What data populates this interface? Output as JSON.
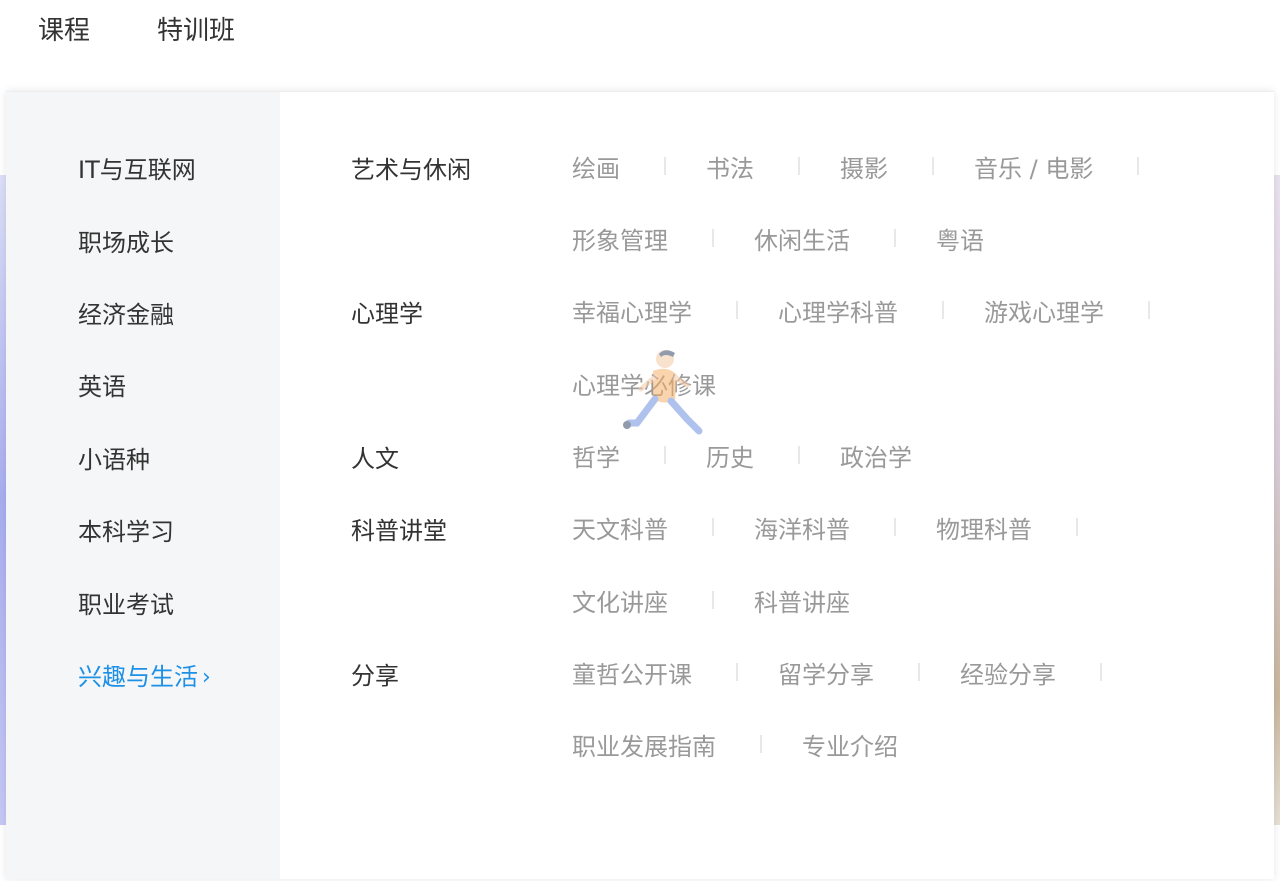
{
  "topnav": {
    "items": [
      {
        "label": "课程"
      },
      {
        "label": "特训班"
      }
    ]
  },
  "sidebar": {
    "categories": [
      {
        "label": "IT与互联网"
      },
      {
        "label": "职场成长"
      },
      {
        "label": "经济金融"
      },
      {
        "label": "英语"
      },
      {
        "label": "小语种"
      },
      {
        "label": "本科学习"
      },
      {
        "label": "职业考试"
      },
      {
        "label": "兴趣与生活",
        "active": true
      }
    ],
    "active_color": "#1e90e6"
  },
  "content": {
    "groups": [
      {
        "title": "艺术与休闲",
        "rows": [
          [
            "绘画",
            "书法",
            "摄影",
            "音乐 / 电影"
          ],
          [
            "形象管理",
            "休闲生活",
            "粤语"
          ]
        ]
      },
      {
        "title": "心理学",
        "rows": [
          [
            "幸福心理学",
            "心理学科普",
            "游戏心理学"
          ],
          [
            "心理学必修课"
          ]
        ]
      },
      {
        "title": "人文",
        "rows": [
          [
            "哲学",
            "历史",
            "政治学"
          ]
        ]
      },
      {
        "title": "科普讲堂",
        "rows": [
          [
            "天文科普",
            "海洋科普",
            "物理科普"
          ],
          [
            "文化讲座",
            "科普讲座"
          ]
        ]
      },
      {
        "title": "分享",
        "rows": [
          [
            "童哲公开课",
            "留学分享",
            "经验分享"
          ],
          [
            "职业发展指南",
            "专业介绍"
          ]
        ]
      }
    ],
    "link_color": "#999999"
  }
}
